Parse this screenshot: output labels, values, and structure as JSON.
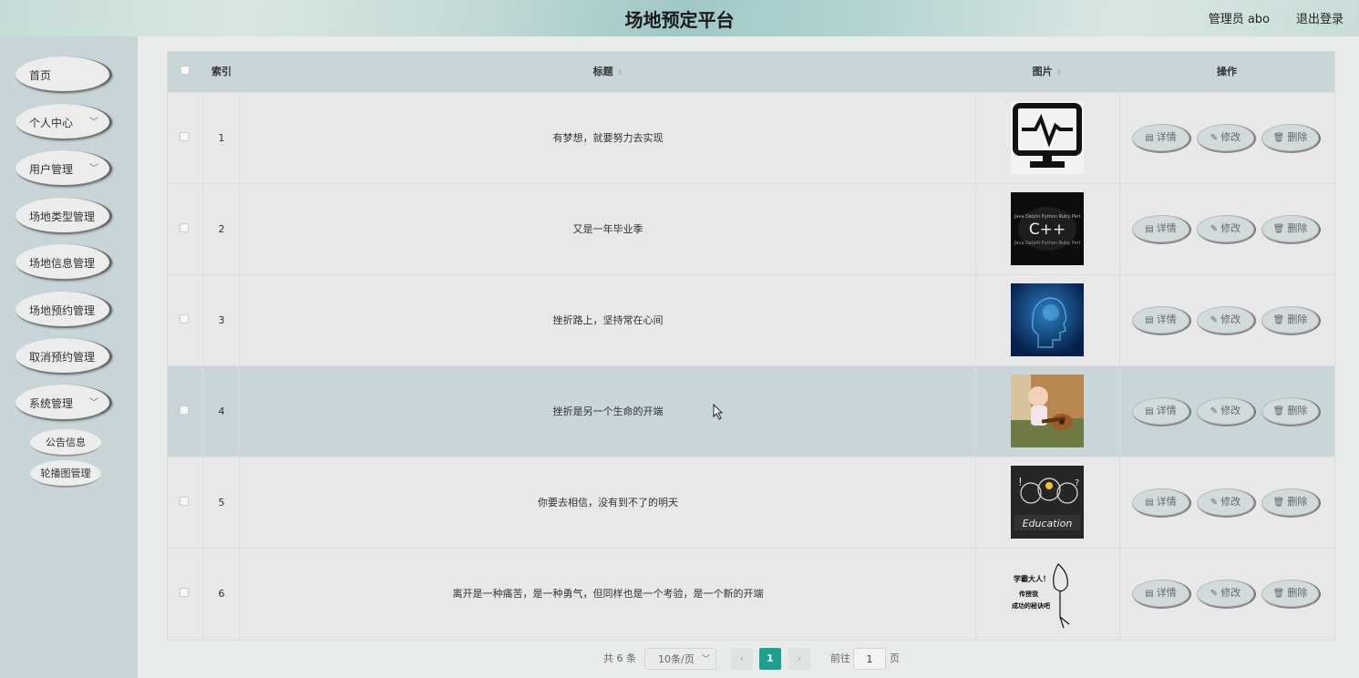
{
  "header": {
    "title": "场地预定平台",
    "admin_label": "管理员 abo",
    "logout": "退出登录"
  },
  "sidebar": {
    "items": [
      {
        "label": "首页",
        "has_arrow": false
      },
      {
        "label": "个人中心",
        "has_arrow": true
      },
      {
        "label": "用户管理",
        "has_arrow": true
      },
      {
        "label": "场地类型管理",
        "has_arrow": false
      },
      {
        "label": "场地信息管理",
        "has_arrow": false
      },
      {
        "label": "场地预约管理",
        "has_arrow": false
      },
      {
        "label": "取消预约管理",
        "has_arrow": false
      },
      {
        "label": "系统管理",
        "has_arrow": true
      }
    ],
    "sub_items": [
      "公告信息",
      "轮播图管理"
    ],
    "arrow_glyph": "﹀"
  },
  "table": {
    "columns": {
      "index": "索引",
      "title": "标题",
      "image": "图片",
      "actions": "操作"
    },
    "sort_glyph": "⇳",
    "rows": [
      {
        "index": "1",
        "title": "有梦想，就要努力去实现",
        "image": "monitor-heartbeat-icon"
      },
      {
        "index": "2",
        "title": "又是一年毕业季",
        "image": "programming-words-cloud"
      },
      {
        "index": "3",
        "title": "挫折路上，坚持常在心间",
        "image": "blue-digital-head"
      },
      {
        "index": "4",
        "title": "挫折是另一个生命的开端",
        "image": "baby-with-guitar"
      },
      {
        "index": "5",
        "title": "你要去相信，没有到不了的明天",
        "image": "education-chalkboard"
      },
      {
        "index": "6",
        "title": "离开是一种痛苦，是一种勇气，但同样也是一个考验，是一个新的开端",
        "image": "cartoon-study-master"
      }
    ],
    "actions": {
      "detail": "详情",
      "edit": "修改",
      "delete": "删除"
    },
    "highlighted_row": 4
  },
  "thumb_text": {
    "cloud_main": "C++",
    "cloud_words": "Java Delphi Python Ruby Perl",
    "education": "Education",
    "cartoon_line1": "学霸大人！",
    "cartoon_line2": "传授我",
    "cartoon_line3": "成功的秘诀吧"
  },
  "pagination": {
    "total": "共 6 条",
    "page_size": "10条/页",
    "current_page": "1",
    "goto_label": "前往",
    "goto_value": "1",
    "page_unit": "页",
    "prev": "‹",
    "next": "›"
  },
  "colors": {
    "accent": "#1ca18f",
    "sidebar_bg": "#c8d5d8",
    "table_header_bg": "#c8d5d9"
  }
}
